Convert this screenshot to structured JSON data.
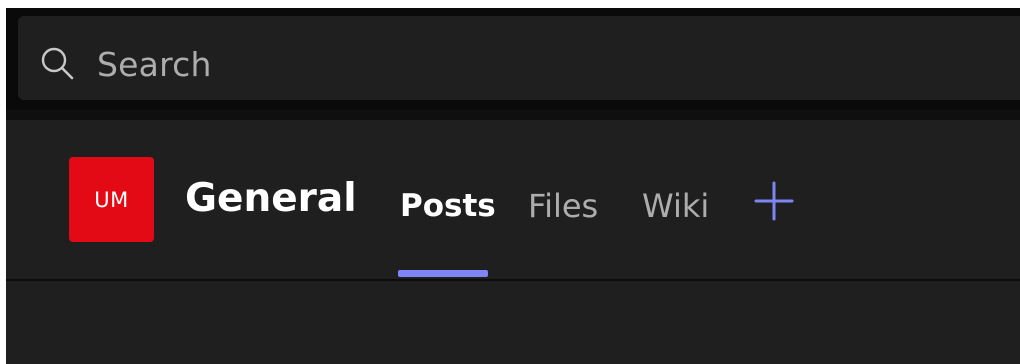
{
  "search": {
    "placeholder": "Search",
    "icon": "search-icon"
  },
  "team": {
    "avatar_initials": "UM",
    "avatar_color": "#e40a15"
  },
  "channel": {
    "name": "General"
  },
  "tabs": [
    {
      "label": "Posts",
      "active": true
    },
    {
      "label": "Files",
      "active": false
    },
    {
      "label": "Wiki",
      "active": false
    }
  ],
  "add_tab": {
    "icon": "plus-icon"
  },
  "colors": {
    "accent": "#7f85f5",
    "background": "#1f1f1f",
    "text_primary": "#ffffff",
    "text_secondary": "#adadad"
  }
}
